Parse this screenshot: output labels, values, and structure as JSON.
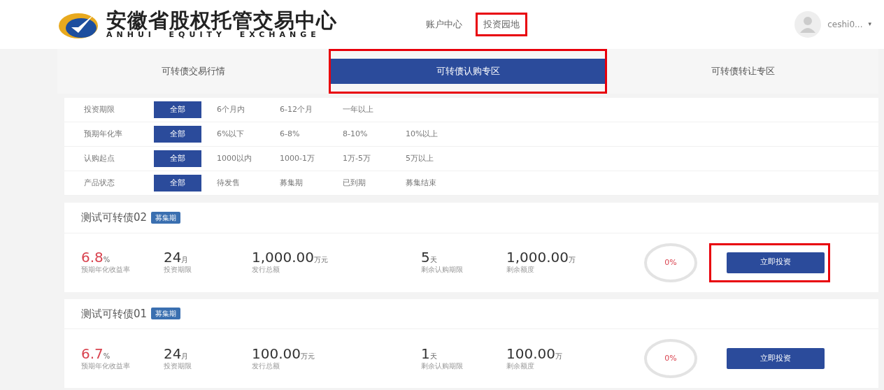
{
  "header": {
    "logo_title": "安徽省股权托管交易中心",
    "logo_subtitle": "ANHUI  EQUITY  EXCHANGE",
    "nav": [
      {
        "label": "账户中心",
        "highlighted": false
      },
      {
        "label": "投资园地",
        "highlighted": true
      }
    ],
    "user": {
      "name": "ceshi0...",
      "caret": "▾"
    }
  },
  "tabs": [
    {
      "label": "可转债交易行情",
      "selected": false,
      "highlighted": false
    },
    {
      "label": "可转债认购专区",
      "selected": true,
      "highlighted": true
    },
    {
      "label": "可转债转让专区",
      "selected": false,
      "highlighted": false
    }
  ],
  "filters": [
    {
      "label": "投资期限",
      "options": [
        {
          "label": "全部",
          "selected": true
        },
        {
          "label": "6个月内",
          "selected": false
        },
        {
          "label": "6-12个月",
          "selected": false
        },
        {
          "label": "一年以上",
          "selected": false
        }
      ]
    },
    {
      "label": "预期年化率",
      "options": [
        {
          "label": "全部",
          "selected": true
        },
        {
          "label": "6%以下",
          "selected": false
        },
        {
          "label": "6-8%",
          "selected": false
        },
        {
          "label": "8-10%",
          "selected": false
        },
        {
          "label": "10%以上",
          "selected": false
        }
      ]
    },
    {
      "label": "认购起点",
      "options": [
        {
          "label": "全部",
          "selected": true
        },
        {
          "label": "1000以内",
          "selected": false
        },
        {
          "label": "1000-1万",
          "selected": false
        },
        {
          "label": "1万-5万",
          "selected": false
        },
        {
          "label": "5万以上",
          "selected": false
        }
      ]
    },
    {
      "label": "产品状态",
      "options": [
        {
          "label": "全部",
          "selected": true
        },
        {
          "label": "待发售",
          "selected": false
        },
        {
          "label": "募集期",
          "selected": false
        },
        {
          "label": "已到期",
          "selected": false
        },
        {
          "label": "募集结束",
          "selected": false
        }
      ]
    }
  ],
  "products": [
    {
      "name": "测试可转债02",
      "badge": "募集期",
      "rate": "6.8",
      "rate_unit": "%",
      "rate_label": "预期年化收益率",
      "term": "24",
      "term_unit": "月",
      "term_label": "投资期限",
      "total": "1,000.00",
      "total_unit": "万元",
      "total_label": "发行总额",
      "days": "5",
      "days_unit": "天",
      "days_label": "剩余认购期限",
      "remaining": "1,000.00",
      "remaining_unit": "万",
      "remaining_label": "剩余额度",
      "progress": "0%",
      "level": 0,
      "button": "立即投资",
      "highlighted": true
    },
    {
      "name": "测试可转债01",
      "badge": "募集期",
      "rate": "6.7",
      "rate_unit": "%",
      "rate_label": "预期年化收益率",
      "term": "24",
      "term_unit": "月",
      "term_label": "投资期限",
      "total": "100.00",
      "total_unit": "万元",
      "total_label": "发行总额",
      "days": "1",
      "days_unit": "天",
      "days_label": "剩余认购期限",
      "remaining": "100.00",
      "remaining_unit": "万",
      "remaining_label": "剩余额度",
      "progress": "0%",
      "level": 0,
      "button": "立即投资",
      "highlighted": false
    }
  ]
}
